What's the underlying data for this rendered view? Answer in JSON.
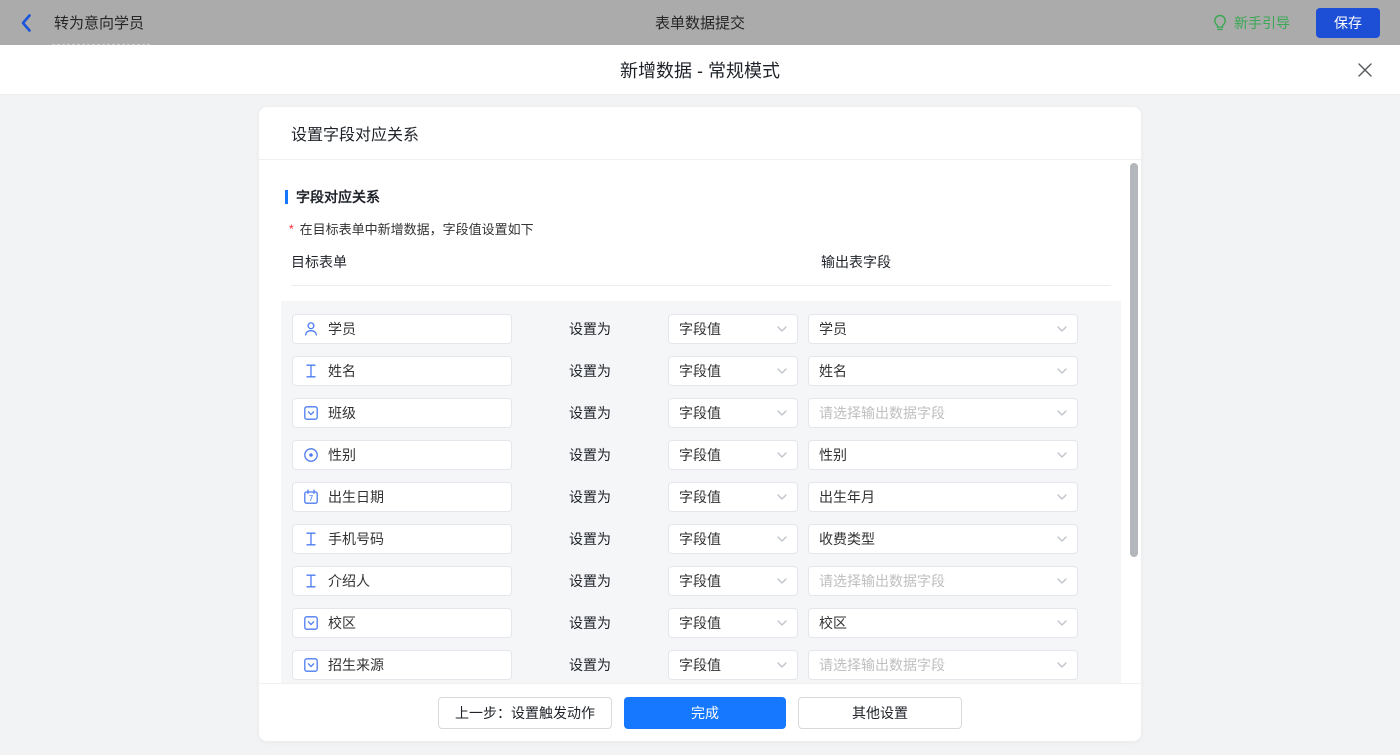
{
  "topbar": {
    "back_label": "转为意向学员",
    "title": "表单数据提交",
    "guide_label": "新手引导",
    "save_label": "保存"
  },
  "modal": {
    "title": "新增数据 - 常规模式"
  },
  "panel": {
    "title": "设置字段对应关系",
    "section": {
      "title": "字段对应关系",
      "required_mark": "*",
      "description": "在目标表单中新增数据，字段值设置如下"
    },
    "columns": {
      "target": "目标表单",
      "output": "输出表字段"
    },
    "set_as_label": "设置为",
    "rows": [
      {
        "field": "学员",
        "icon": "person-icon",
        "mode": "字段值",
        "output": "学员",
        "is_placeholder": false
      },
      {
        "field": "姓名",
        "icon": "text-icon",
        "mode": "字段值",
        "output": "姓名",
        "is_placeholder": false
      },
      {
        "field": "班级",
        "icon": "select-icon",
        "mode": "字段值",
        "output": "请选择输出数据字段",
        "is_placeholder": true
      },
      {
        "field": "性别",
        "icon": "radio-icon",
        "mode": "字段值",
        "output": "性别",
        "is_placeholder": false
      },
      {
        "field": "出生日期",
        "icon": "date-icon",
        "mode": "字段值",
        "output": "出生年月",
        "is_placeholder": false
      },
      {
        "field": "手机号码",
        "icon": "text-icon",
        "mode": "字段值",
        "output": "收费类型",
        "is_placeholder": false
      },
      {
        "field": "介绍人",
        "icon": "text-icon",
        "mode": "字段值",
        "output": "请选择输出数据字段",
        "is_placeholder": true
      },
      {
        "field": "校区",
        "icon": "select-icon",
        "mode": "字段值",
        "output": "校区",
        "is_placeholder": false
      },
      {
        "field": "招生来源",
        "icon": "select-icon",
        "mode": "字段值",
        "output": "请选择输出数据字段",
        "is_placeholder": true
      },
      {
        "field": "",
        "icon": "",
        "mode": "",
        "output": "",
        "is_placeholder": false,
        "partial": true
      }
    ]
  },
  "footer": {
    "prev_label": "上一步：设置触发动作",
    "finish_label": "完成",
    "other_label": "其他设置"
  },
  "colors": {
    "accent_blue": "#1677ff",
    "save_button_blue": "#1d4fd6",
    "guide_green": "#3aa854",
    "field_icon_blue": "#4d7df2",
    "required_red": "#f5222d",
    "topbar_gray": "#ababab",
    "rows_background": "#f5f6f8"
  }
}
